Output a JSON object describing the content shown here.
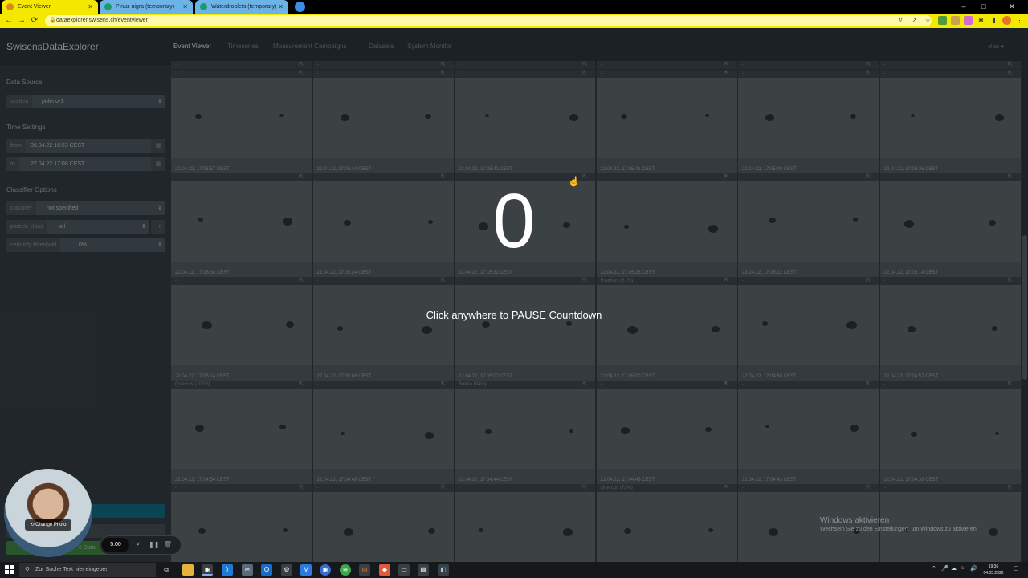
{
  "browser": {
    "tabs": [
      {
        "title": "Event Viewer",
        "favicon_color": "#d98b1a"
      },
      {
        "title": "Pinus nigra (temporary)",
        "favicon_color": "#1a9b6a"
      },
      {
        "title": "Waterdroplets (temporary)",
        "favicon_color": "#1a9b6a"
      }
    ],
    "url": "dataexplorer.swisens.ch/eventviewer",
    "new_tab_icon": "+",
    "back_icon": "←",
    "forward_icon": "→",
    "reload_icon": "⟳",
    "minimize_icon": "–",
    "maximize_icon": "□",
    "close_icon": "✕"
  },
  "app": {
    "brand": "SwisensDataExplorer",
    "nav": [
      "Event Viewer",
      "Timeseries",
      "Measurement Campaigns",
      "Datasets",
      "System Monitor"
    ],
    "user": "elias ▾"
  },
  "sidebar": {
    "data_source_heading": "Data Source",
    "system_label": "system",
    "system_value": "poleno-1",
    "time_settings_heading": "Time Settings",
    "from_label": "from",
    "from_value": "06.04.22 16:53 CEST",
    "to_label": "to",
    "to_value": "22.04.22 17:08 CEST",
    "classifier_heading": "Classifier Options",
    "classifier_label": "classifier",
    "classifier_value": "not specified",
    "particle_class_label": "particle class",
    "particle_class_value": "all",
    "certainty_label": "certainty threshold",
    "certainty_value": "0%",
    "save_button_label": "e Data"
  },
  "grid": {
    "rows": [
      [
        {
          "label": "-",
          "timestamp": "22.04.22, 17:05:57 CEST"
        },
        {
          "label": "-",
          "timestamp": "22.04.22, 17:05:44 CEST"
        },
        {
          "label": "-",
          "timestamp": "22.04.22, 17:05:41 CEST"
        },
        {
          "label": "-",
          "timestamp": "22.04.22, 17:05:41 CEST"
        },
        {
          "label": "-",
          "timestamp": "22.04.22, 17:05:40 CEST"
        },
        {
          "label": "-",
          "timestamp": "22.04.22, 17:05:36 CEST"
        }
      ],
      [
        {
          "label": "-",
          "timestamp": "22.04.22, 17:05:36 CEST"
        },
        {
          "label": "-",
          "timestamp": "22.04.22, 17:05:34 CEST"
        },
        {
          "label": "-",
          "timestamp": "22.04.22, 17:05:32 CEST"
        },
        {
          "label": "-",
          "timestamp": "22.04.22, 17:05:26 CEST"
        },
        {
          "label": "-",
          "timestamp": "22.04.22, 17:05:22 CEST"
        },
        {
          "label": "-",
          "timestamp": "22.04.22, 17:05:14 CEST"
        }
      ],
      [
        {
          "label": "-",
          "timestamp": "22.04.22, 17:05:14 CEST"
        },
        {
          "label": "-",
          "timestamp": "22.04.22, 17:05:08 CEST"
        },
        {
          "label": "-",
          "timestamp": "22.04.22, 17:05:07 CEST"
        },
        {
          "label": "Fraxinus (81%)",
          "timestamp": "22.04.22, 17:05:00 CEST"
        },
        {
          "label": "-",
          "timestamp": "22.04.22, 17:04:58 CEST"
        },
        {
          "label": "-",
          "timestamp": "22.04.22, 17:04:57 CEST"
        }
      ],
      [
        {
          "label": "Quercus (100%)",
          "timestamp": "22.04.22, 17:04:54 CEST"
        },
        {
          "label": "-",
          "timestamp": "22.04.22, 17:04:49 CEST"
        },
        {
          "label": "Betula (94%)",
          "timestamp": "22.04.22, 17:04:44 CEST"
        },
        {
          "label": "-",
          "timestamp": "22.04.22, 17:04:43 CEST"
        },
        {
          "label": "-",
          "timestamp": "22.04.22, 17:04:43 CEST"
        },
        {
          "label": "-",
          "timestamp": "22.04.22, 17:04:39 CEST"
        }
      ],
      [
        {
          "label": "-",
          "timestamp": ""
        },
        {
          "label": "-",
          "timestamp": ""
        },
        {
          "label": "-",
          "timestamp": ""
        },
        {
          "label": "Quercus (72%)",
          "timestamp": ""
        },
        {
          "label": "-",
          "timestamp": ""
        },
        {
          "label": "-",
          "timestamp": ""
        }
      ]
    ],
    "top_partial_row_labels": [
      "-",
      "-",
      "-",
      "-",
      "-",
      "-"
    ]
  },
  "overlay": {
    "countdown": "0",
    "message": "Click anywhere to PAUSE Countdown"
  },
  "windows_activation": {
    "title": "Windows aktivieren",
    "subtitle": "Wechseln Sie zu den Einstellungen, um Windows zu aktivieren."
  },
  "webcam": {
    "change_photo_label": "Change Photo",
    "timer": "5:00"
  },
  "taskbar": {
    "search_placeholder": "Zur Suche Text hier eingeben",
    "time": "19:36",
    "date": "04.05.2022"
  }
}
